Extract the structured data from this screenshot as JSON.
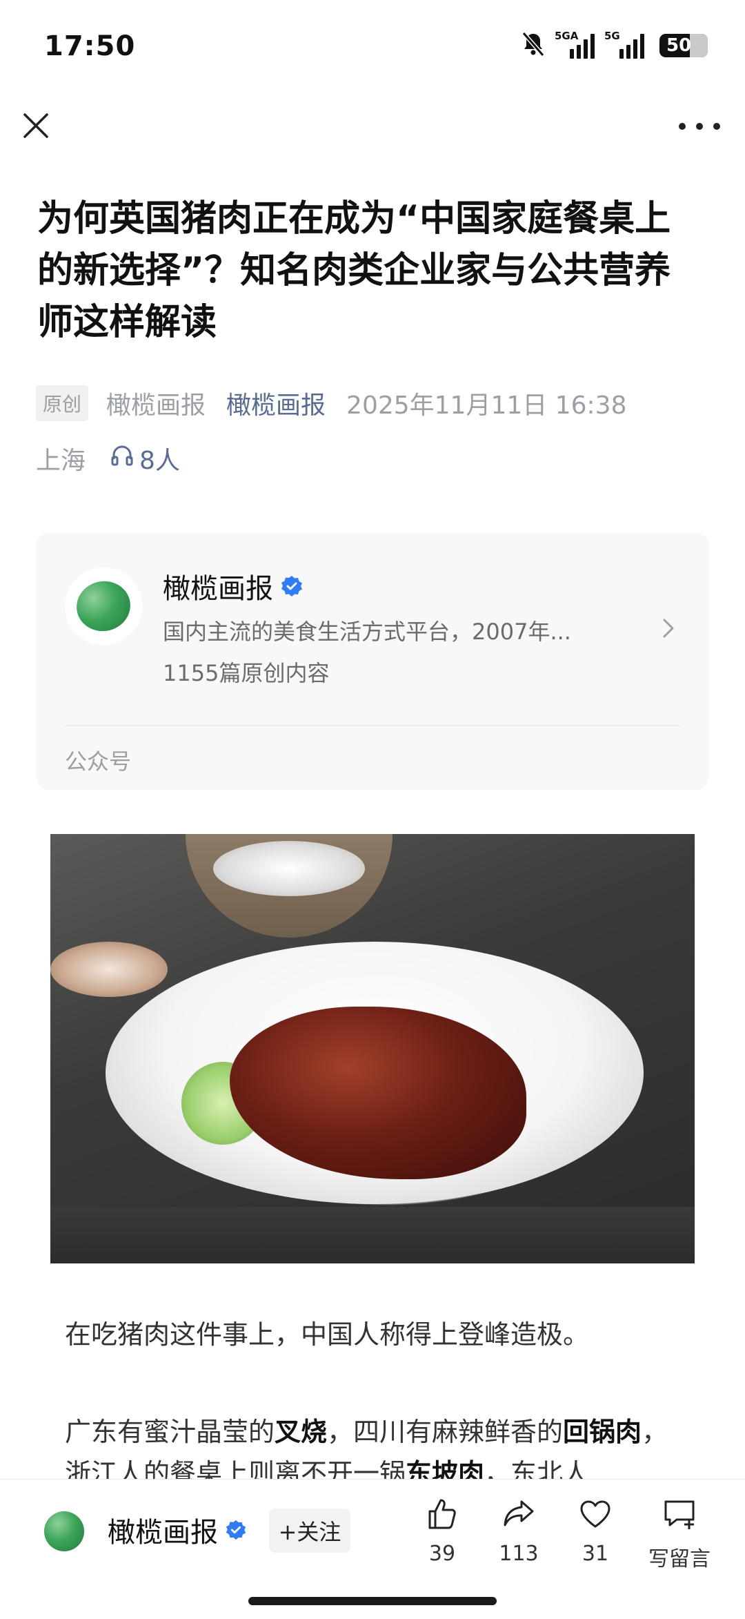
{
  "status_bar": {
    "time": "17:50",
    "mute_icon": "bell-slash-icon",
    "signal1_label": "5GA",
    "signal2_label": "5G",
    "battery": "50"
  },
  "nav": {
    "close_icon": "close-icon",
    "more_icon": "more-dots-icon"
  },
  "article": {
    "title": "为何英国猪肉正在成为“中国家庭餐桌上的新选择”？知名肉类企业家与公共营养师这样解读",
    "original_tag": "原创",
    "author": "橄榄画报",
    "account_link": "橄榄画报",
    "datetime": "2025年11月11日 16:38",
    "location": "上海",
    "listeners": "8人"
  },
  "account_card": {
    "name": "橄榄画报",
    "description": "国内主流的美食生活方式平台，2007年...",
    "count": "1155篇原创内容",
    "footer": "公众号"
  },
  "body": {
    "p1": "在吃猪肉这件事上，中国人称得上登峰造极。",
    "p2_a": "广东有蜜汁晶莹的",
    "p2_b": "叉烧",
    "p2_c": "，四川有麻辣鲜香的",
    "p2_d": "回锅肉",
    "p2_e": "，浙江人的餐桌上则离不开一锅",
    "p2_f": "东坡肉",
    "p2_g": "，东北人"
  },
  "bottom_bar": {
    "account_name": "橄榄画报",
    "follow_label": "+关注",
    "like_count": "39",
    "share_count": "113",
    "fav_count": "31",
    "comment_label": "写留言"
  },
  "colors": {
    "link": "#576b95",
    "meta_gray": "#9aa0a6",
    "verified_blue": "#2f7cf6",
    "brand_green": "#3da55a"
  }
}
